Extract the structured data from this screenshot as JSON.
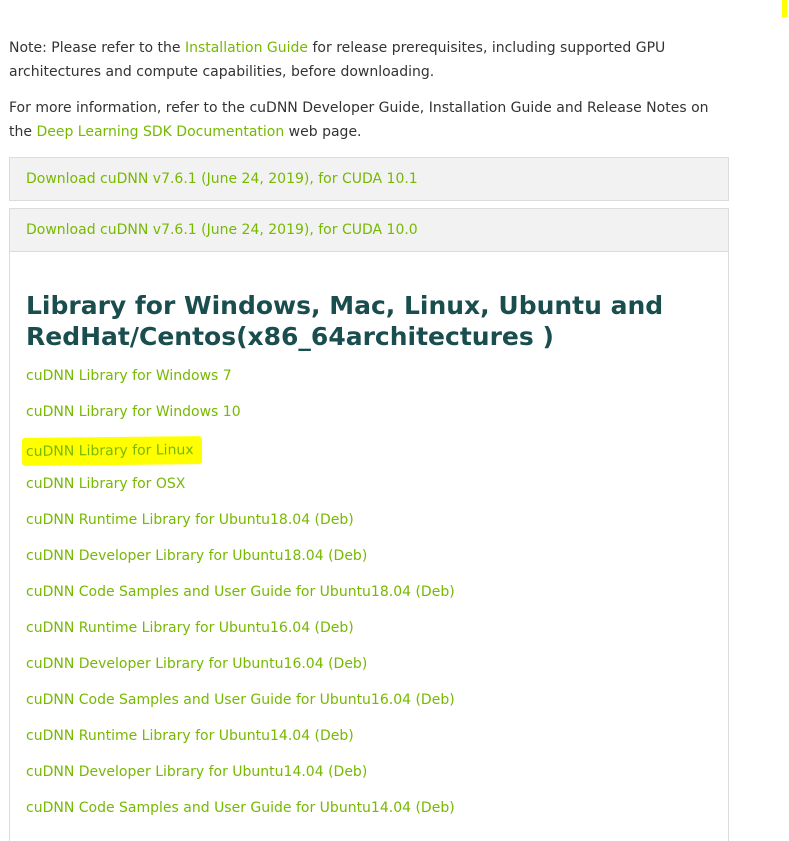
{
  "note": {
    "prefix": "Note: Please refer to the ",
    "link": "Installation Guide",
    "suffix": " for release prerequisites, including supported GPU architectures and compute capabilities, before downloading."
  },
  "info": {
    "prefix": "For more information, refer to the cuDNN Developer Guide, Installation Guide and Release Notes on the ",
    "link": "Deep Learning SDK Documentation",
    "suffix": " web page."
  },
  "accordions": [
    {
      "label": "Download cuDNN v7.6.1 (June 24, 2019), for CUDA 10.1"
    },
    {
      "label": "Download cuDNN v7.6.1 (June 24, 2019), for CUDA 10.0"
    }
  ],
  "panel": {
    "title_line1": "Library for Windows, Mac, Linux, Ubuntu and",
    "title_line2": "RedHat/Centos(x86_64architectures )",
    "links": [
      {
        "label": "cuDNN Library for Windows 7"
      },
      {
        "label": "cuDNN Library for Windows 10"
      },
      {
        "label": "cuDNN Library for Linux",
        "highlighted": true
      },
      {
        "label": "cuDNN Library for OSX"
      },
      {
        "label": "cuDNN Runtime Library for Ubuntu18.04 (Deb)"
      },
      {
        "label": "cuDNN Developer Library for Ubuntu18.04 (Deb)"
      },
      {
        "label": "cuDNN Code Samples and User Guide for Ubuntu18.04 (Deb)"
      },
      {
        "label": "cuDNN Runtime Library for Ubuntu16.04 (Deb)"
      },
      {
        "label": "cuDNN Developer Library for Ubuntu16.04 (Deb)"
      },
      {
        "label": "cuDNN Code Samples and User Guide for Ubuntu16.04 (Deb)"
      },
      {
        "label": "cuDNN Runtime Library for Ubuntu14.04 (Deb)"
      },
      {
        "label": "cuDNN Developer Library for Ubuntu14.04 (Deb)"
      },
      {
        "label": "cuDNN Code Samples and User Guide for Ubuntu14.04 (Deb)"
      }
    ]
  },
  "colors": {
    "link": "#76b900",
    "heading": "#1a4d4d",
    "highlight": "#ffff00",
    "accordion_bg": "#f2f2f2"
  }
}
